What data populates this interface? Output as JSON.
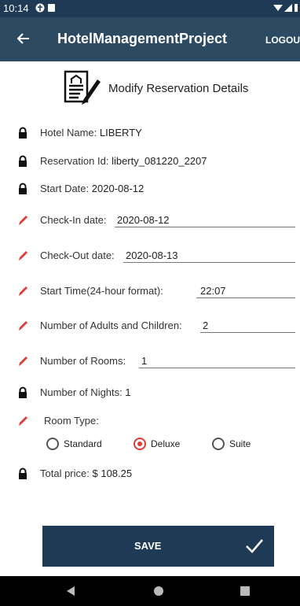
{
  "status_bar": {
    "time": "10:14"
  },
  "app_bar": {
    "back_icon": "arrow-left",
    "title": "HotelManagementProject",
    "logout": "LOGOUT"
  },
  "header": {
    "icon": "edit-document",
    "title": "Modify Reservation Details"
  },
  "fields": {
    "hotel_name": {
      "label": "Hotel Name:",
      "value": "LIBERTY",
      "icon": "lock"
    },
    "reservation_id": {
      "label": "Reservation Id:",
      "value": "liberty_081220_2207",
      "icon": "lock"
    },
    "start_date": {
      "label": "Start Date:",
      "value": "2020-08-12",
      "icon": "lock"
    },
    "check_in": {
      "label": "Check-In date:",
      "value": "2020-08-12",
      "icon": "pencil"
    },
    "check_out": {
      "label": "Check-Out date:",
      "value": "2020-08-13",
      "icon": "pencil"
    },
    "start_time": {
      "label": "Start Time(24-hour format):",
      "value": "22:07",
      "icon": "pencil"
    },
    "adults_children": {
      "label": "Number of Adults and Children:",
      "value": "2",
      "icon": "pencil"
    },
    "rooms": {
      "label": "Number of Rooms:",
      "value": "1",
      "icon": "pencil"
    },
    "nights": {
      "label": "Number of Nights:",
      "value": "1",
      "icon": "lock"
    },
    "room_type": {
      "label": "Room Type:",
      "icon": "pencil",
      "options": [
        "Standard",
        "Deluxe",
        "Suite"
      ],
      "selected": "Deluxe"
    },
    "total_price": {
      "label": "Total price:",
      "value": "$ 108.25",
      "icon": "lock"
    }
  },
  "save_button": {
    "label": "SAVE",
    "icon": "checkmark"
  },
  "colors": {
    "primary": "#2d4a63",
    "dark": "#1e3a55",
    "accent": "#e53935"
  }
}
